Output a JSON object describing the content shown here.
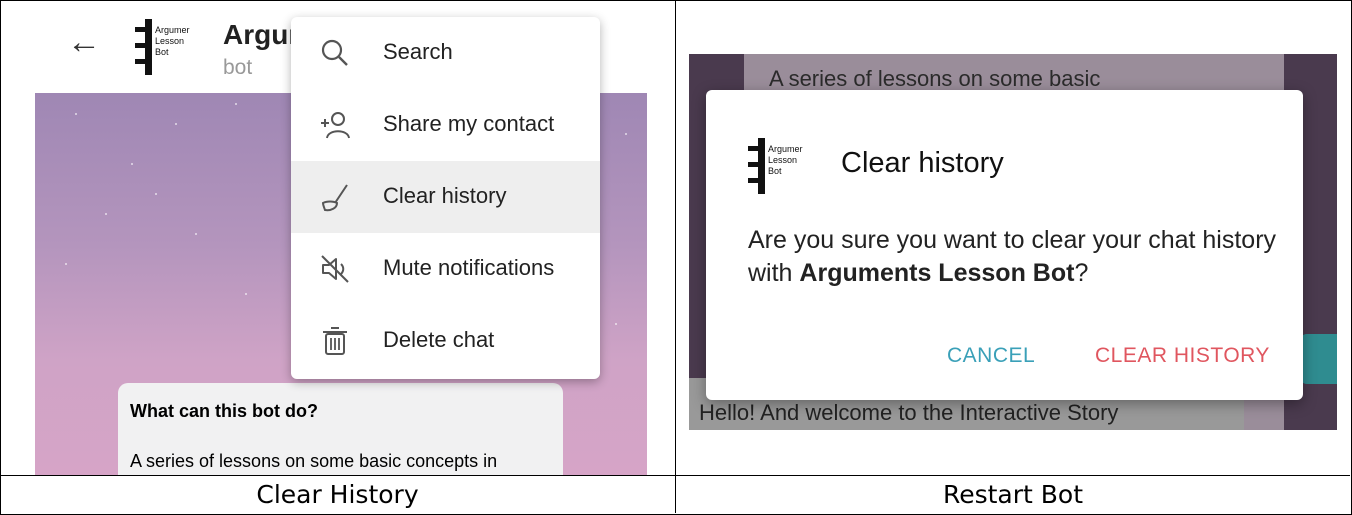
{
  "left_panel": {
    "caption": "Clear History",
    "header": {
      "back_icon": "arrow-left-icon",
      "logo_lines": [
        "Argumer",
        "Lesson",
        "Bot"
      ],
      "title": "Argum",
      "subtitle": "bot"
    },
    "menu": {
      "items": [
        {
          "label": "Search",
          "icon": "search-icon"
        },
        {
          "label": "Share my contact",
          "icon": "share-contact-icon"
        },
        {
          "label": "Clear history",
          "icon": "broom-icon"
        },
        {
          "label": "Mute notifications",
          "icon": "mute-icon"
        },
        {
          "label": "Delete chat",
          "icon": "trash-icon"
        }
      ],
      "active_index": 2
    },
    "intro_card": {
      "title": "What can this bot do?",
      "body": "A series of lessons on some basic concepts in arguments and logic created"
    }
  },
  "right_panel": {
    "caption": "Restart Bot",
    "background_text_top": "A series of lessons on some basic",
    "background_text_bottom": "Hello! And welcome to the Interactive Story",
    "dialog": {
      "logo_lines": [
        "Argumer",
        "Lesson",
        "Bot"
      ],
      "title": "Clear history",
      "body_prefix": "Are you sure you want to clear your chat history with ",
      "body_bold": "Arguments Lesson Bot",
      "body_suffix": "?",
      "cancel_label": "CANCEL",
      "confirm_label": "CLEAR HISTORY"
    }
  },
  "colors": {
    "cancel": "#3aa0b8",
    "confirm": "#e0565f",
    "menu_active": "#eeeeee"
  }
}
